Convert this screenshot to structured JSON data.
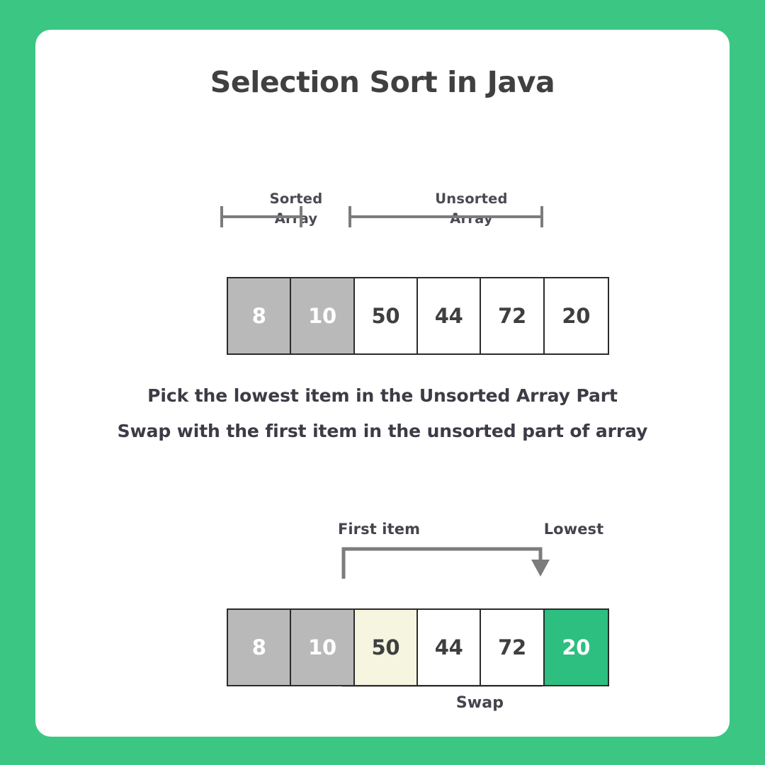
{
  "theme": {
    "background_green": "#3BC783",
    "card_background": "#FFFFFF",
    "sorted_cell": "#B9B9B9",
    "highlight_cell": "#F6F5E0",
    "lowest_cell": "#2DBF80",
    "text_dark": "#3F3F3F",
    "line_gray": "#7C7C7C"
  },
  "header": {
    "title": "Selection Sort in Java"
  },
  "step1": {
    "region_labels": [
      {
        "name": "sorted",
        "line1": "Sorted",
        "line2": "Array"
      },
      {
        "name": "unsorted",
        "line1": "Unsorted",
        "line2": "Array"
      }
    ],
    "array": [
      {
        "value": "8",
        "state": "sorted"
      },
      {
        "value": "10",
        "state": "sorted"
      },
      {
        "value": "50",
        "state": "unsorted"
      },
      {
        "value": "44",
        "state": "unsorted"
      },
      {
        "value": "72",
        "state": "unsorted"
      },
      {
        "value": "20",
        "state": "unsorted"
      }
    ]
  },
  "instructions": {
    "line1": "Pick the lowest item in the Unsorted Array Part",
    "line2": "Swap with the first item in the unsorted part of array"
  },
  "step2": {
    "labels": {
      "first_item": "First item",
      "lowest": "Lowest",
      "swap": "Swap"
    },
    "array": [
      {
        "value": "8",
        "state": "sorted"
      },
      {
        "value": "10",
        "state": "sorted"
      },
      {
        "value": "50",
        "state": "highlight"
      },
      {
        "value": "44",
        "state": "unsorted"
      },
      {
        "value": "72",
        "state": "unsorted"
      },
      {
        "value": "20",
        "state": "lowest"
      }
    ]
  }
}
